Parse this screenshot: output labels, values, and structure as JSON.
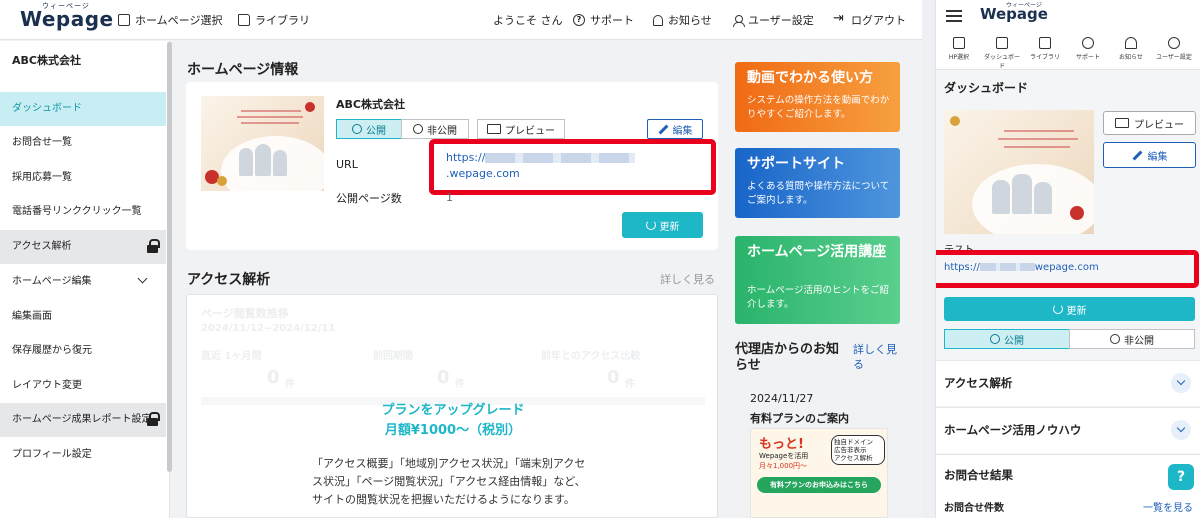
{
  "app": {
    "logo": "Wepage",
    "logo_kana": "ウィーページ"
  },
  "topnav": {
    "site_select": "ホームページ選択",
    "library": "ライブラリ",
    "welcome": "ようこそ さん",
    "support": "サポート",
    "notice": "お知らせ",
    "user_settings": "ユーザー設定",
    "logout": "ログアウト"
  },
  "sidebar": {
    "company": "ABC株式会社",
    "items": [
      {
        "label": "ダッシュボード"
      },
      {
        "label": "お問合せ一覧"
      },
      {
        "label": "採用応募一覧"
      },
      {
        "label": "電話番号リンククリック一覧"
      },
      {
        "label": "アクセス解析"
      },
      {
        "label": "ホームページ編集"
      },
      {
        "label": "編集画面"
      },
      {
        "label": "保存履歴から復元"
      },
      {
        "label": "レイアウト変更"
      },
      {
        "label": "ホームページ成果レポート設定"
      },
      {
        "label": "プロフィール設定"
      }
    ]
  },
  "homepage_info": {
    "title": "ホームページ情報",
    "site_name": "ABC株式会社",
    "public_label": "公開",
    "private_label": "非公開",
    "preview_label": "プレビュー",
    "edit_label": "編集",
    "url_label": "URL",
    "url_prefix": "https://",
    "url_suffix": ".wepage.com",
    "pages_label": "公開ページ数",
    "pages_value": "1",
    "update_label": "更新"
  },
  "access": {
    "title": "アクセス解析",
    "more": "詳しく見る",
    "faded_title": "ページ閲覧数推移",
    "faded_range": "2024/11/12~2024/12/11",
    "faded_col1": "直近 1ヶ月間",
    "faded_col2": "前回期間",
    "faded_col3": "前年とのアクセス比較",
    "faded_unit": "件",
    "upgrade_line1": "プランをアップグレード",
    "upgrade_line2": "月額¥1000～（税別）",
    "upgrade_desc": "「アクセス概要」「地域別アクセス状況」「端末別アクセス状況」「ページ閲覧状況」「アクセス経由情報」など、サイトの閲覧状況を把握いただけるようになります。"
  },
  "banners": [
    {
      "title": "動画でわかる使い方",
      "desc": "システムの操作方法を動画でわかりやすくご紹介します。",
      "color": "#f06a14"
    },
    {
      "title": "サポートサイト",
      "desc": "よくある質問や操作方法についてご案内します。",
      "color": "#1865c9"
    },
    {
      "title": "ホームページ活用講座",
      "desc": "ホームページ活用のヒントをご紹介します。",
      "color": "#29b36b"
    }
  ],
  "news": {
    "title": "代理店からのお知らせ",
    "more": "詳しく見る",
    "date": "2024/11/27",
    "headline": "有料プランのご案内",
    "img_big": "もっと!",
    "img_sub": "Wepageを活用",
    "img_price": "月々1,000円～",
    "img_badges": [
      "独自ドメイン",
      "広告非表示",
      "アクセス解析"
    ],
    "img_cta": "有料プランのお申込みはこちら"
  },
  "mobile": {
    "nav": [
      "HP選択",
      "ダッシュボード",
      "ライブラリ",
      "サポート",
      "お知らせ",
      "ユーザー設定"
    ],
    "dashboard_title": "ダッシュボード",
    "preview": "プレビュー",
    "edit": "編集",
    "site_name": "テスト",
    "url_prefix": "https://",
    "url_suffix": "wepage.com",
    "update": "更新",
    "public": "公開",
    "private": "非公開",
    "sections": [
      "アクセス解析",
      "ホームページ活用ノウハウ"
    ],
    "inquiry_title": "お問合せ結果",
    "inquiry_count": "お問合せ件数",
    "inquiry_more": "一覧を見る"
  },
  "colors": {
    "accent": "#1eb7c7",
    "link": "#1f5fb8",
    "highlight": "#e8001d"
  }
}
